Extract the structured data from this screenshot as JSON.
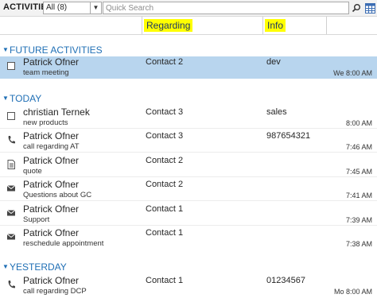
{
  "toolbar": {
    "title": "ACTIVITIES",
    "view_selected": "All (8)",
    "search_placeholder": "Quick Search"
  },
  "columns": {
    "regarding": "Regarding",
    "info": "Info"
  },
  "colors": {
    "section_accent": "#1f6fb5",
    "selected_row": "#b8d5ee",
    "header_highlight": "#ffff00"
  },
  "sections": {
    "future": {
      "label": "FUTURE ACTIVITIES",
      "rows": [
        {
          "icon": "task-icon",
          "name": "Patrick Ofner",
          "sub": "team meeting",
          "regarding": "Contact 2",
          "info": "dev",
          "time": "We 8:00 AM"
        }
      ]
    },
    "today": {
      "label": "TODAY",
      "rows": [
        {
          "icon": "task-icon",
          "name": "christian Ternek",
          "sub": "new products",
          "regarding": "Contact 3",
          "info": "sales",
          "time": "8:00 AM"
        },
        {
          "icon": "phone-icon",
          "name": "Patrick Ofner",
          "sub": "call regarding AT",
          "regarding": "Contact 3",
          "info": "987654321",
          "time": "7:46 AM"
        },
        {
          "icon": "quote-icon",
          "name": "Patrick Ofner",
          "sub": "quote",
          "regarding": "Contact 2",
          "info": "",
          "time": "7:45 AM"
        },
        {
          "icon": "email-icon",
          "name": "Patrick Ofner",
          "sub": "Questions about GC",
          "regarding": "Contact 2",
          "info": "",
          "time": "7:41 AM"
        },
        {
          "icon": "email-icon",
          "name": "Patrick Ofner",
          "sub": "Support",
          "regarding": "Contact 1",
          "info": "",
          "time": "7:39 AM"
        },
        {
          "icon": "email-icon",
          "name": "Patrick Ofner",
          "sub": "reschedule appointment",
          "regarding": "Contact 1",
          "info": "",
          "time": "7:38 AM"
        }
      ]
    },
    "yesterday": {
      "label": "YESTERDAY",
      "rows": [
        {
          "icon": "phone-icon",
          "name": "Patrick Ofner",
          "sub": "call regarding DCP",
          "regarding": "Contact 1",
          "info": "01234567",
          "time": "Mo 8:00 AM"
        }
      ]
    }
  }
}
